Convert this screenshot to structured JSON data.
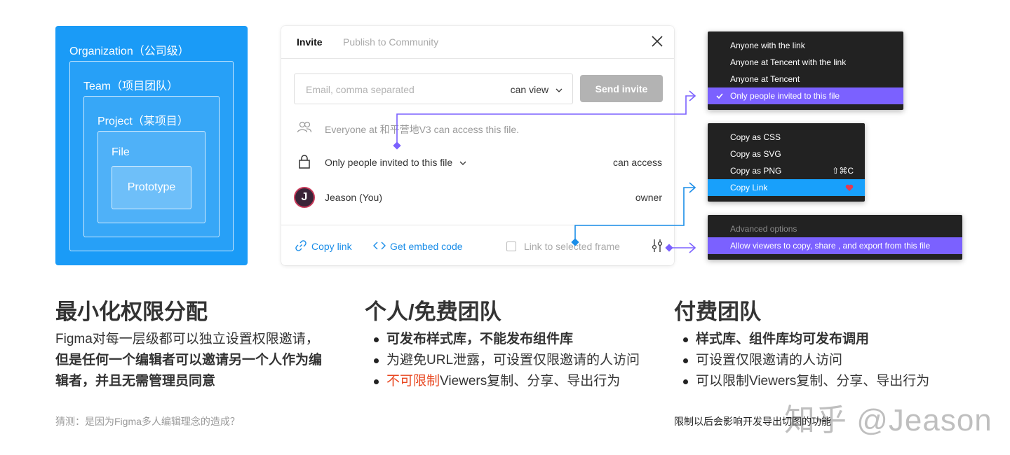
{
  "hierarchy": {
    "organization": "Organization（公司级）",
    "team": "Team（项目团队）",
    "project": "Project（某项目）",
    "file": "File",
    "prototype": "Prototype"
  },
  "dialog": {
    "tabs": [
      "Invite",
      "Publish to Community"
    ],
    "email_placeholder": "Email, comma separated",
    "permission": "can view",
    "send_button": "Send invite",
    "everyone_text": "Everyone at 和平营地V3 can access this file.",
    "access_selector": "Only people invited to this file",
    "access_right": "can access",
    "user_name": "Jeason (You)",
    "user_role": "owner",
    "avatar_letter": "J",
    "copy_link": "Copy link",
    "embed_code": "Get embed code",
    "link_selected_frame": "Link to selected frame"
  },
  "access_menu": {
    "items": [
      "Anyone with the link",
      "Anyone at Tencent with the link",
      "Anyone at Tencent",
      "Only people invited to this file"
    ],
    "selected_index": 3
  },
  "copy_menu": {
    "items": [
      "Copy as CSS",
      "Copy as SVG",
      "Copy as PNG",
      "Copy Link"
    ],
    "png_shortcut": "⇧⌘C",
    "selected_index": 3
  },
  "advanced_menu": {
    "header": "Advanced options",
    "item": "Allow viewers to copy, share , and export from this file"
  },
  "sections": {
    "left": {
      "title": "最小化权限分配",
      "line1": "Figma对每一层级都可以独立设置权限邀请，",
      "line2": "但是任何一个编辑者可以邀请另一个人作为编",
      "line3": "辑者，并且无需管理员同意",
      "note": "猜测：是因为Figma多人编辑理念的造成？"
    },
    "middle": {
      "title": "个人/免费团队",
      "bullet1": "可发布样式库，不能发布组件库",
      "bullet2": "为避免URL泄露，可设置仅限邀请的人访问",
      "bullet3_red": "不可限制",
      "bullet3_rest": "Viewers复制、分享、导出行为"
    },
    "right": {
      "title": "付费团队",
      "bullet1": "样式库、组件库均可发布调用",
      "bullet2": "可设置仅限邀请的人访问",
      "bullet3": "可以限制Viewers复制、分享、导出行为",
      "note": "限制以后会影响开发导出切图的功能"
    }
  },
  "watermark": "知乎 @Jeason",
  "colors": {
    "org_blue": "#1a9bf7",
    "purple": "#7b61ff",
    "blue_select": "#18a0fb",
    "link_blue": "#1a8de8",
    "red": "#e8461f",
    "menu_bg": "#222222"
  }
}
